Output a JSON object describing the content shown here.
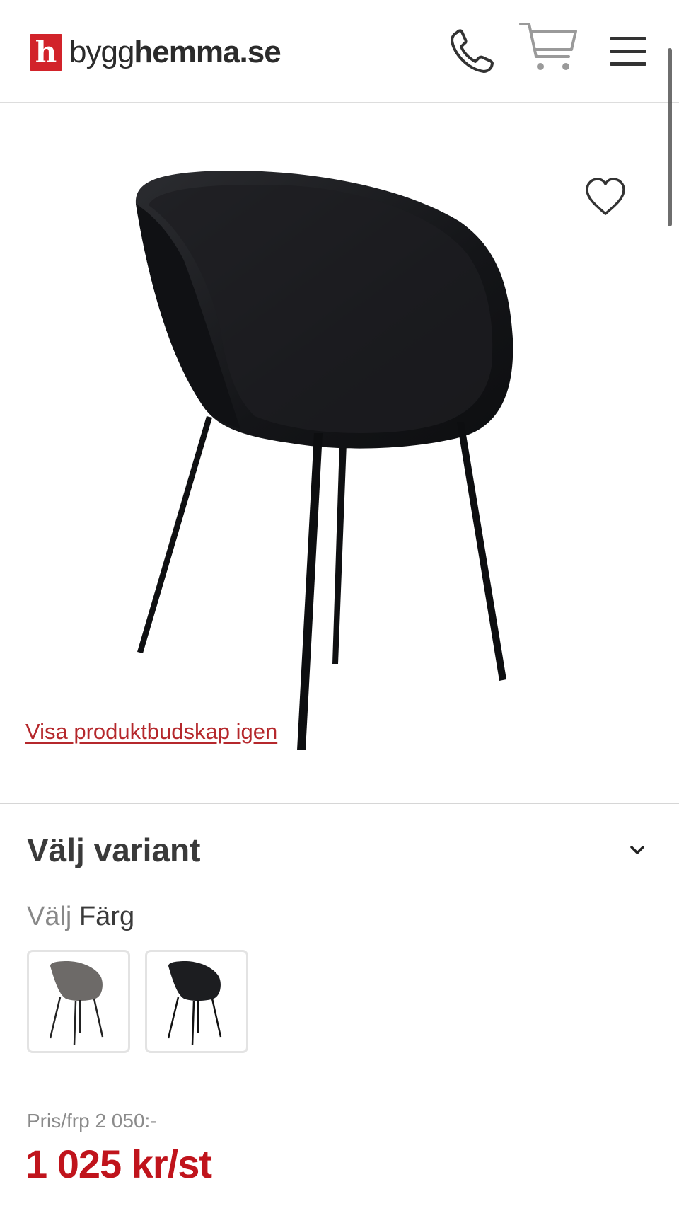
{
  "header": {
    "logo_mark": "h",
    "logo_text_a": "bygg",
    "logo_text_b": "hemma",
    "logo_text_c": ".se",
    "icons": [
      "phone-icon",
      "cart-icon",
      "menu-icon"
    ]
  },
  "hero": {
    "favorite_icon": "heart-icon",
    "show_message_link": "Visa produktbudskap igen"
  },
  "variant": {
    "title": "Välj variant",
    "chevron_icon": "chevron-down-icon",
    "color_label_prefix": "Välj",
    "color_label_name": "Färg",
    "swatches": [
      {
        "color": "#6d6a68"
      },
      {
        "color": "#1c1d20"
      }
    ]
  },
  "price": {
    "old": "Pris/frp 2 050:-",
    "current": "1 025 kr/st"
  },
  "colors": {
    "brand_red": "#d2232a",
    "price_red": "#c0141c",
    "link_red": "#b5282c"
  }
}
